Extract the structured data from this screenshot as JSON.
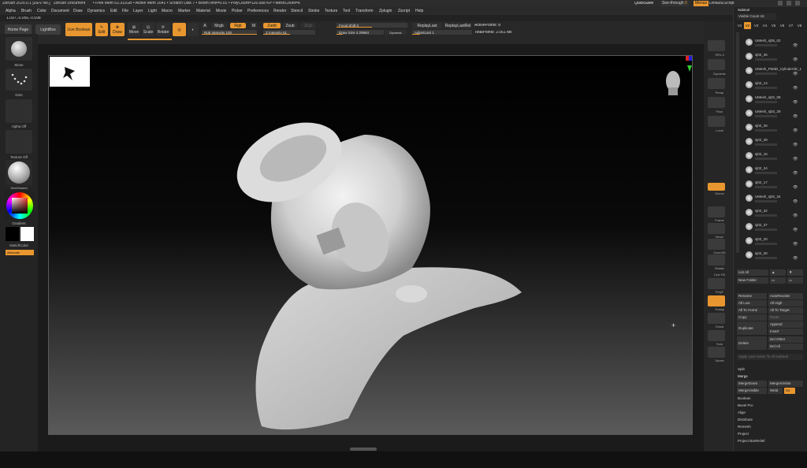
{
  "titlebar": {
    "app": "ZBrush 2025.0.1 [DEV No.]",
    "document": "ZBrush Document",
    "stats": "• Free Mem 52.311GB • Active Mem 1641 • Scratch Disk 7 • BoomTime=0.01 • PolyCount=126.588 KP • MeshCount=8",
    "quicksave": "QuickSave",
    "seethrough": "See-through",
    "seethrough_value": "0",
    "menus": "Menus",
    "defaultzscript": "DefaultZScript"
  },
  "menubar": {
    "items": [
      "Alpha",
      "Brush",
      "Color",
      "Document",
      "Draw",
      "Dynamics",
      "Edit",
      "File",
      "Layer",
      "Light",
      "Macro",
      "Marker",
      "Material",
      "Movie",
      "Picker",
      "Preferences",
      "Render",
      "Stencil",
      "Stroke",
      "Texture",
      "Tool",
      "Transform",
      "Zplugin",
      "Zscript",
      "Help"
    ]
  },
  "coords": "1.097,-0.056,-0.598",
  "shelf": {
    "home_page": "Home Page",
    "lightbox": "LightBox",
    "live_boolean": "Live Boolean",
    "edit": "Edit",
    "draw": "Draw",
    "move": "Move",
    "scale": "Scale",
    "rotate": "Rotate",
    "a_btn": "A",
    "mrgb": "Mrgb",
    "rgb": "Rgb",
    "m": "M",
    "zadd": "Zadd",
    "zsub": "Zsub",
    "zcut": "Zcut",
    "rgb_intensity": "Rgb Intensity 100",
    "z_intensity": "Z Intensity 51",
    "focal_shift": "Focal Shift 0",
    "draw_size": "Draw Size 4.29964",
    "dynamic": "Dynamic",
    "replay_last": "ReplayLast",
    "replay_last_rel": "ReplayLastRel",
    "adjust_last": "AdjustLast 1",
    "active_points": "ActivePoints: 8",
    "total_points": "TotalPoints: 2.061 Mil"
  },
  "lefttray": {
    "move": "Move",
    "dots": "Dots",
    "alpha_off": "Alpha Off",
    "texture_off": "Texture Off",
    "material": "SkinShade4",
    "gradient": "Gradient",
    "switch_color": "SwitchColor",
    "alternate": "Alternate"
  },
  "righttools": [
    "SPix 3",
    "Dynamic",
    "Persp",
    "Floor",
    "Local",
    "Gizmo",
    "Frame",
    "Move",
    "Zoom3D",
    "Rotate",
    "Line Fill",
    "PolyF",
    "Transp",
    "Ghost",
    "Solo",
    "Xpose"
  ],
  "subtool": {
    "title": "Subtool",
    "visible_count": "Visible Count 16",
    "versions": [
      "V1",
      "V2",
      "V3",
      "V4",
      "V5",
      "V6",
      "V7",
      "V8"
    ],
    "items": [
      "UMesh_sj05_02",
      "sj02_35",
      "UMesh_PM3D_Cylinder3D_1",
      "sj02_14",
      "UMesh_sj02_08",
      "UMesh_sj02_29",
      "sj02_36",
      "sj02_28",
      "sj02_16",
      "sj02_24",
      "sj02_17",
      "UMesh_sj02_34",
      "sj02_32",
      "sj02_37",
      "sj02_20",
      "sj02_30"
    ],
    "list_all": "List All",
    "new_folder": "New Folder",
    "rename": "Rename",
    "auto_reorder": "AutoReorder",
    "all_low": "All Low",
    "all_high": "All High",
    "all_to_home": "All To Home",
    "all_to_target": "All To Target",
    "copy": "Copy",
    "paste": "Paste",
    "duplicate": "Duplicate",
    "append": "Append",
    "insert": "Insert",
    "delete": "Delete",
    "del_other": "Del Other",
    "del_all": "Del All",
    "apply_last_action": "Apply Last Action To All Subtool",
    "split": "Split",
    "merge": "Merge",
    "merge_down": "MergeDown",
    "merge_similar": "MergeSimilar",
    "merge_visible": "MergeVisible",
    "weld": "Weld",
    "uv": "Uv",
    "boolean": "Boolean",
    "bevel_pro": "Bevel Pro",
    "align": "Align",
    "distribute": "Distribute",
    "remesh": "Remesh",
    "project": "Project",
    "project_basrelief": "Project BasRelief"
  },
  "colors": {
    "accent": "#e8962f",
    "panel": "#262626",
    "canvas_border": "#5a5a5a"
  }
}
